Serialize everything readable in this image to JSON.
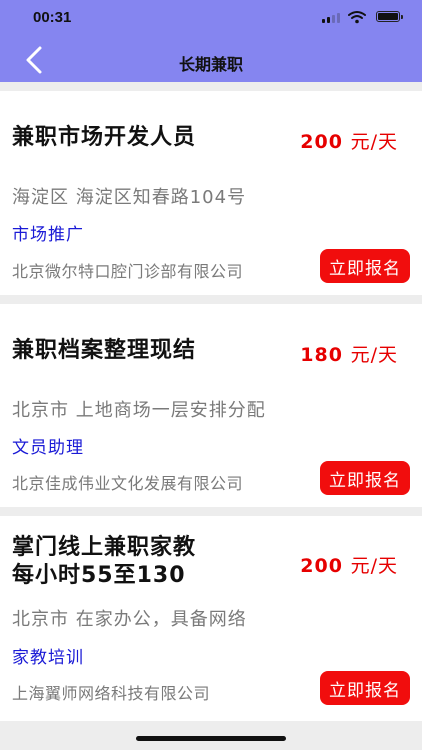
{
  "status_bar": {
    "time": "00:31"
  },
  "nav": {
    "title": "长期兼职"
  },
  "jobs": [
    {
      "title": "兼职市场开发人员",
      "salary": "200",
      "unit": "元/天",
      "address": "海淀区 海淀区知春路104号",
      "category": "市场推广",
      "company": "北京微尔特口腔门诊部有限公司",
      "button": "立即报名"
    },
    {
      "title": "兼职档案整理现结",
      "salary": "180",
      "unit": "元/天",
      "address": "北京市 上地商场一层安排分配",
      "category": "文员助理",
      "company": "北京佳成伟业文化发展有限公司",
      "button": "立即报名"
    },
    {
      "title_line1": "掌门线上兼职家教",
      "title_line2": "每小时55至130",
      "salary": "200",
      "unit": "元/天",
      "address": "北京市 在家办公，具备网络",
      "category": "家教培训",
      "company": "上海翼师网络科技有限公司",
      "button": "立即报名"
    }
  ],
  "colors": {
    "header": "#8585f0",
    "salary": "#e60000",
    "category": "#1a1ad6",
    "button": "#f10d0d"
  }
}
